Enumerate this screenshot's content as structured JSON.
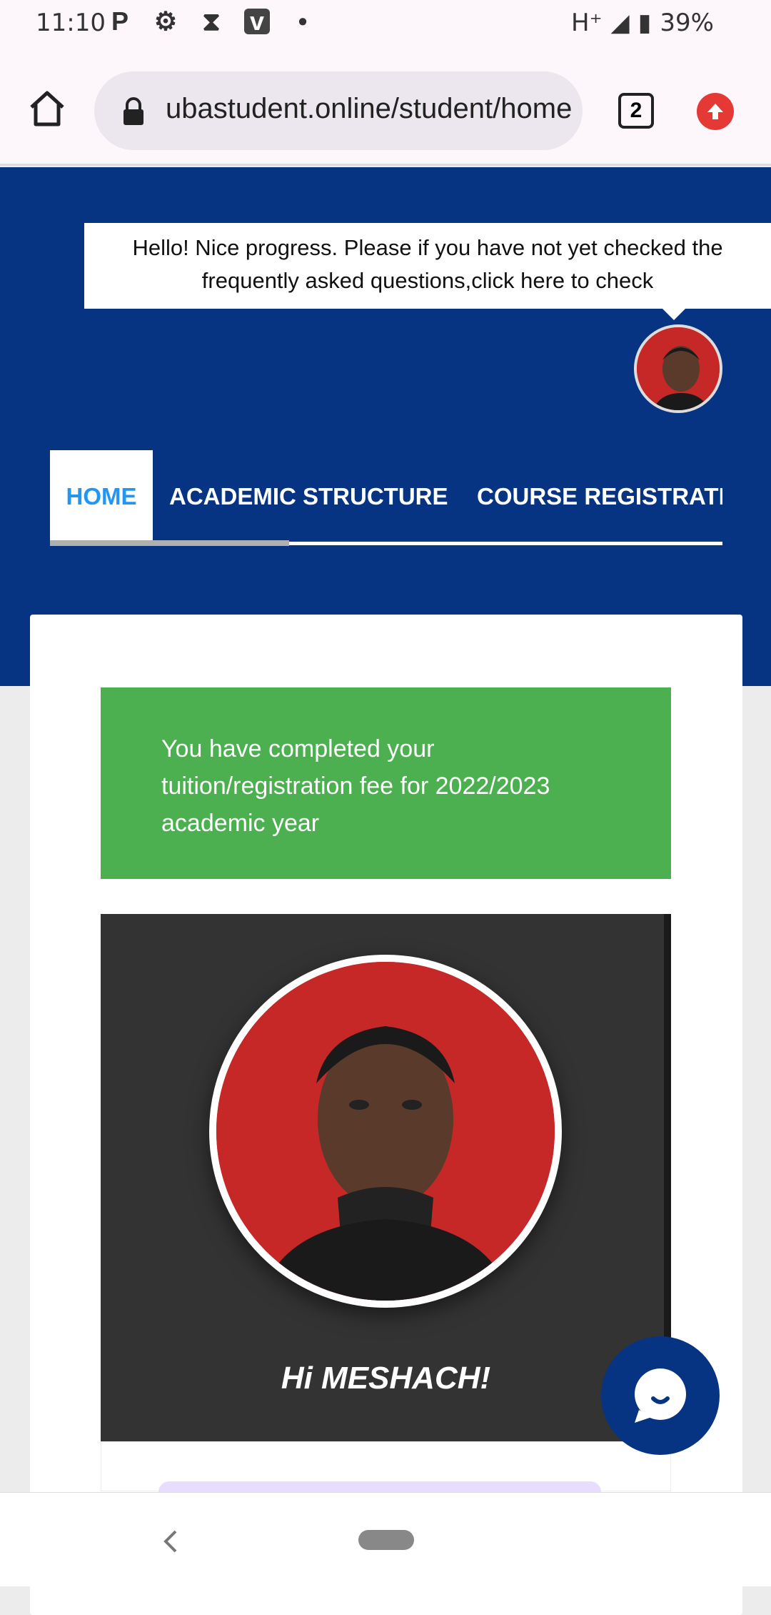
{
  "status_bar": {
    "time": "11:10",
    "network": "H⁺",
    "battery": "39%"
  },
  "browser": {
    "url": "ubastudent.online/student/home",
    "tab_count": "2"
  },
  "hero": {
    "tooltip": "Hello! Nice progress. Please if you have not yet checked the frequently asked questions,click here to check"
  },
  "nav": {
    "items": [
      {
        "label": "HOME",
        "active": true
      },
      {
        "label": "ACADEMIC STRUCTURE"
      },
      {
        "label": "COURSE REGISTRATION"
      }
    ]
  },
  "alert": {
    "text": "You have completed your tuition/registration fee for 2022/2023 academic year"
  },
  "profile": {
    "greeting": "Hi MESHACH!"
  },
  "colors": {
    "primary": "#063483",
    "success": "#4caf50",
    "accent": "#2196f3"
  }
}
